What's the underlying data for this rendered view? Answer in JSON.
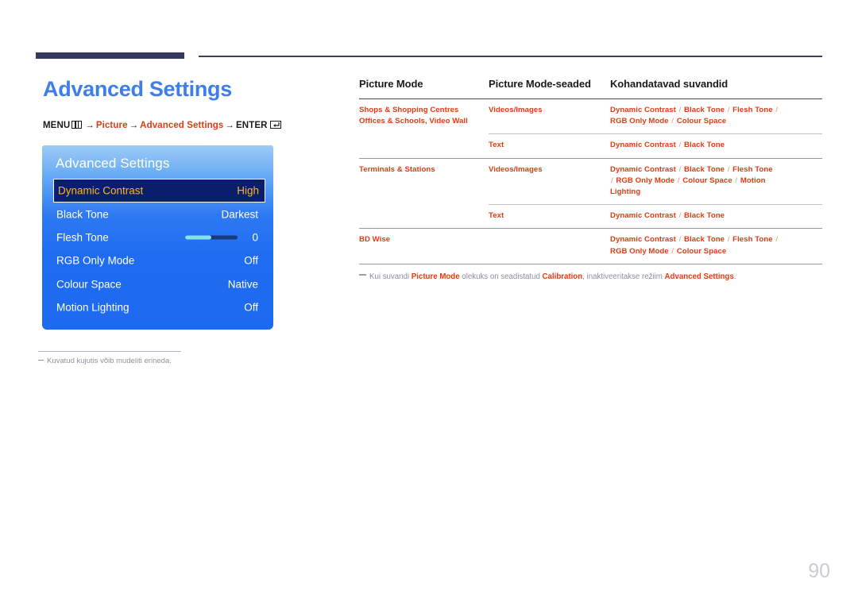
{
  "page": {
    "title": "Advanced Settings",
    "number": "90",
    "title_color": "#3d7ee8",
    "accent_color": "#e23b12"
  },
  "menu_path": {
    "menu_label": "MENU",
    "menu_icon": "menu-bars-icon",
    "arrow": "→",
    "item1": "Picture",
    "item2": "Advanced Settings",
    "enter_label": "ENTER",
    "enter_icon": "enter-return-icon"
  },
  "osd": {
    "title": "Advanced Settings",
    "rows": [
      {
        "label": "Dynamic Contrast",
        "value": "High",
        "selected": true,
        "type": "value"
      },
      {
        "label": "Black Tone",
        "value": "Darkest",
        "selected": false,
        "type": "value"
      },
      {
        "label": "Flesh Tone",
        "value": "0",
        "selected": false,
        "type": "slider",
        "fill_percent": 50
      },
      {
        "label": "RGB Only Mode",
        "value": "Off",
        "selected": false,
        "type": "value"
      },
      {
        "label": "Colour Space",
        "value": "Native",
        "selected": false,
        "type": "value"
      },
      {
        "label": "Motion Lighting",
        "value": "Off",
        "selected": false,
        "type": "value"
      }
    ]
  },
  "left_note": "Kuvatud kujutis võib mudeliti erineda.",
  "table": {
    "headers": {
      "col1": "Picture Mode",
      "col2": "Picture Mode-seaded",
      "col3": "Kohandatavad suvandid"
    },
    "rows": [
      {
        "group": true,
        "col1_line1": "Shops & Shopping Centres",
        "col1_line2": "Offices & Schools, Video Wall",
        "col2": "Videos/Images",
        "col3_line1": "Dynamic Contrast / Black Tone / Flesh Tone /",
        "col3_line2": "RGB Only Mode / Colour Space"
      },
      {
        "group": false,
        "col1_line1": "",
        "col1_line2": "",
        "col2": "Text",
        "col3_line1": "Dynamic Contrast / Black Tone",
        "col3_line2": ""
      },
      {
        "group": true,
        "col1_line1": "Terminals & Stations",
        "col1_line2": "",
        "col2": "Videos/Images",
        "col3_line1": "Dynamic Contrast / Black Tone / Flesh Tone",
        "col3_line2": "/ RGB Only Mode / Colour Space / Motion",
        "col3_line3": "Lighting"
      },
      {
        "group": false,
        "col1_line1": "",
        "col1_line2": "",
        "col2": "Text",
        "col3_line1": "Dynamic Contrast / Black Tone",
        "col3_line2": ""
      },
      {
        "group": true,
        "col1_line1": "BD Wise",
        "col1_line2": "",
        "col2": "",
        "col3_line1": "Dynamic Contrast / Black Tone / Flesh Tone /",
        "col3_line2": "RGB Only Mode / Colour Space"
      }
    ]
  },
  "right_note": {
    "t1": "Kui suvandi ",
    "b1": "Picture Mode",
    "t2": " olekuks on seadistatud ",
    "b2": "Calibration",
    "t3": ", inaktiveeritakse režiim ",
    "b3": "Advanced Settings",
    "t4": "."
  }
}
